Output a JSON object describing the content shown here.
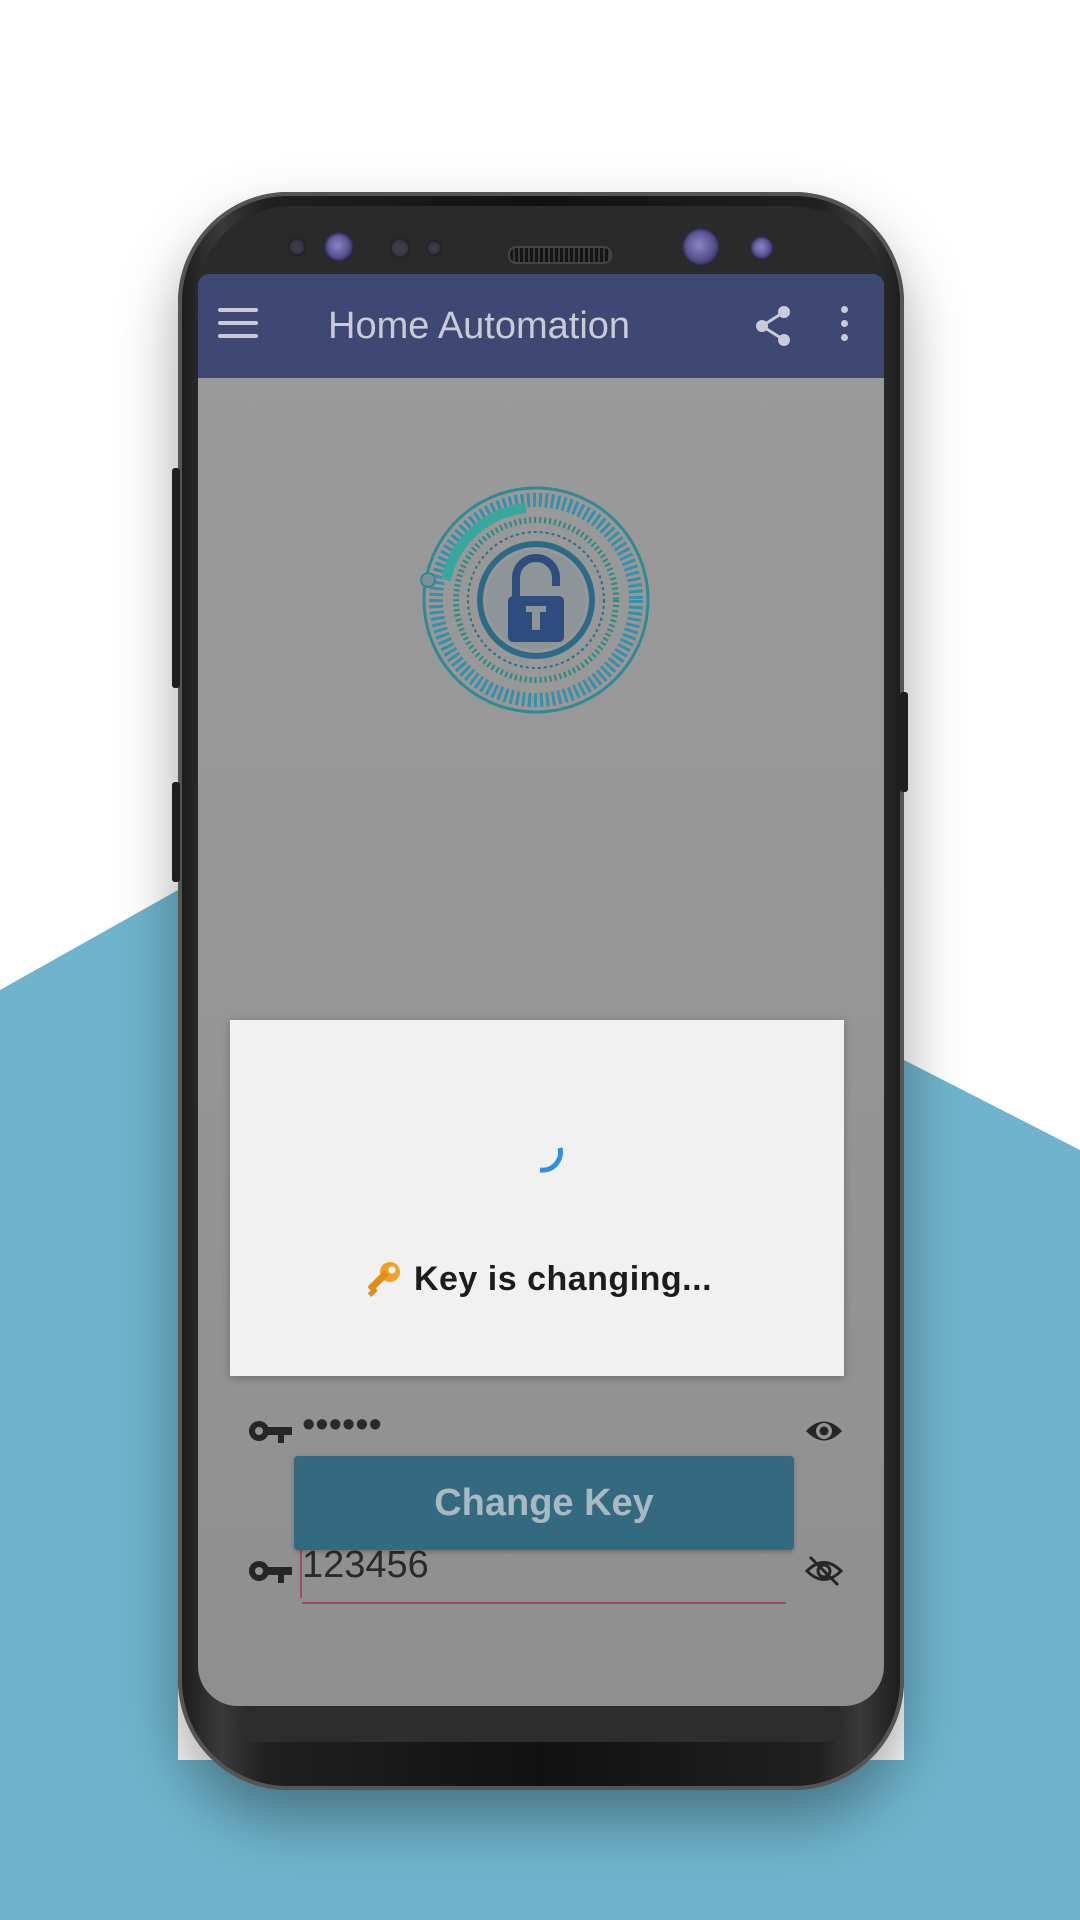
{
  "app": {
    "title": "Home Automation"
  },
  "dialog": {
    "message": "Key is changing..."
  },
  "fields": {
    "old_key_value": "••••••",
    "new_key_value": "123456"
  },
  "actions": {
    "change_key_label": "Change Key"
  },
  "colors": {
    "appbar": "#3e4872",
    "button": "#346a80",
    "underline": "#a04b66",
    "background_shape": "#6fb4cc",
    "spinner": "#2f8fe0"
  },
  "icons": [
    "menu-icon",
    "share-icon",
    "more-vert-icon",
    "lock-icon",
    "key-icon",
    "eye-icon",
    "eye-off-icon",
    "spinner-icon"
  ]
}
